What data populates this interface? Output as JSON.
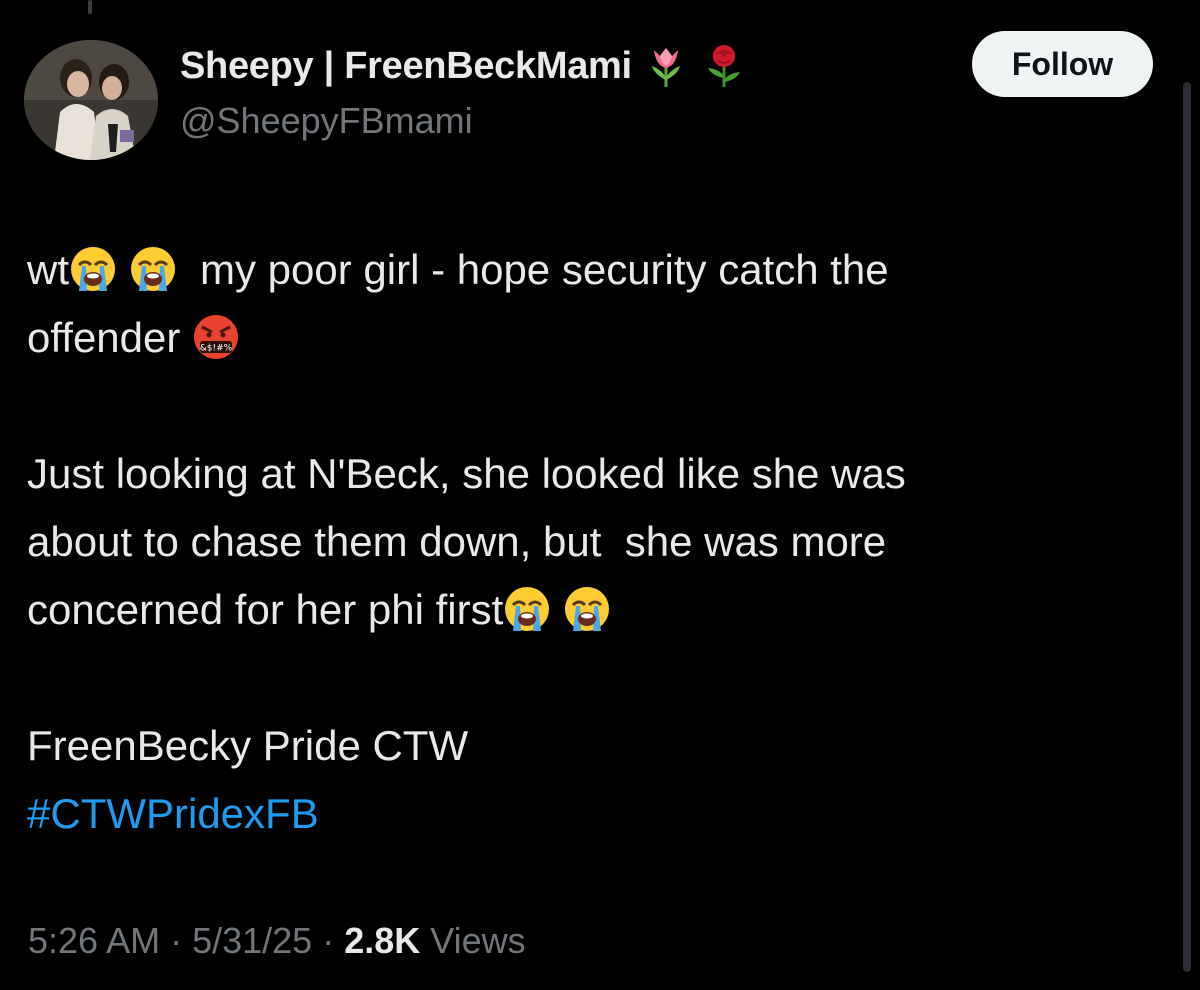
{
  "author": {
    "display_name": "Sheepy | FreenBeckMami",
    "handle": "@SheepyFBmami",
    "name_emojis": [
      "tulip-emoji",
      "rose-emoji"
    ]
  },
  "follow_button": {
    "label": "Follow"
  },
  "tweet": {
    "line1_a": "wt",
    "line1_b": "my poor girl - hope security catch the",
    "line2": "offender",
    "para2_line1": "Just looking at N'Beck, she looked like she was",
    "para2_line2": "about to chase them down, but  she was more",
    "para2_line3": "concerned for her phi first",
    "para3": "FreenBecky Pride CTW",
    "hashtag": "#CTWPridexFB",
    "emojis": [
      "loudly-crying-face-emoji",
      "face-with-symbols-on-mouth-emoji"
    ]
  },
  "meta": {
    "time": "5:26 AM",
    "sep1": " · ",
    "date": "5/31/25",
    "sep2": " · ",
    "views_count": "2.8K",
    "views_label": " Views"
  },
  "colors": {
    "background": "#000000",
    "text": "#e7e9ea",
    "muted": "#71767b",
    "link": "#1d9bf0",
    "button_bg": "#eff3f4"
  }
}
